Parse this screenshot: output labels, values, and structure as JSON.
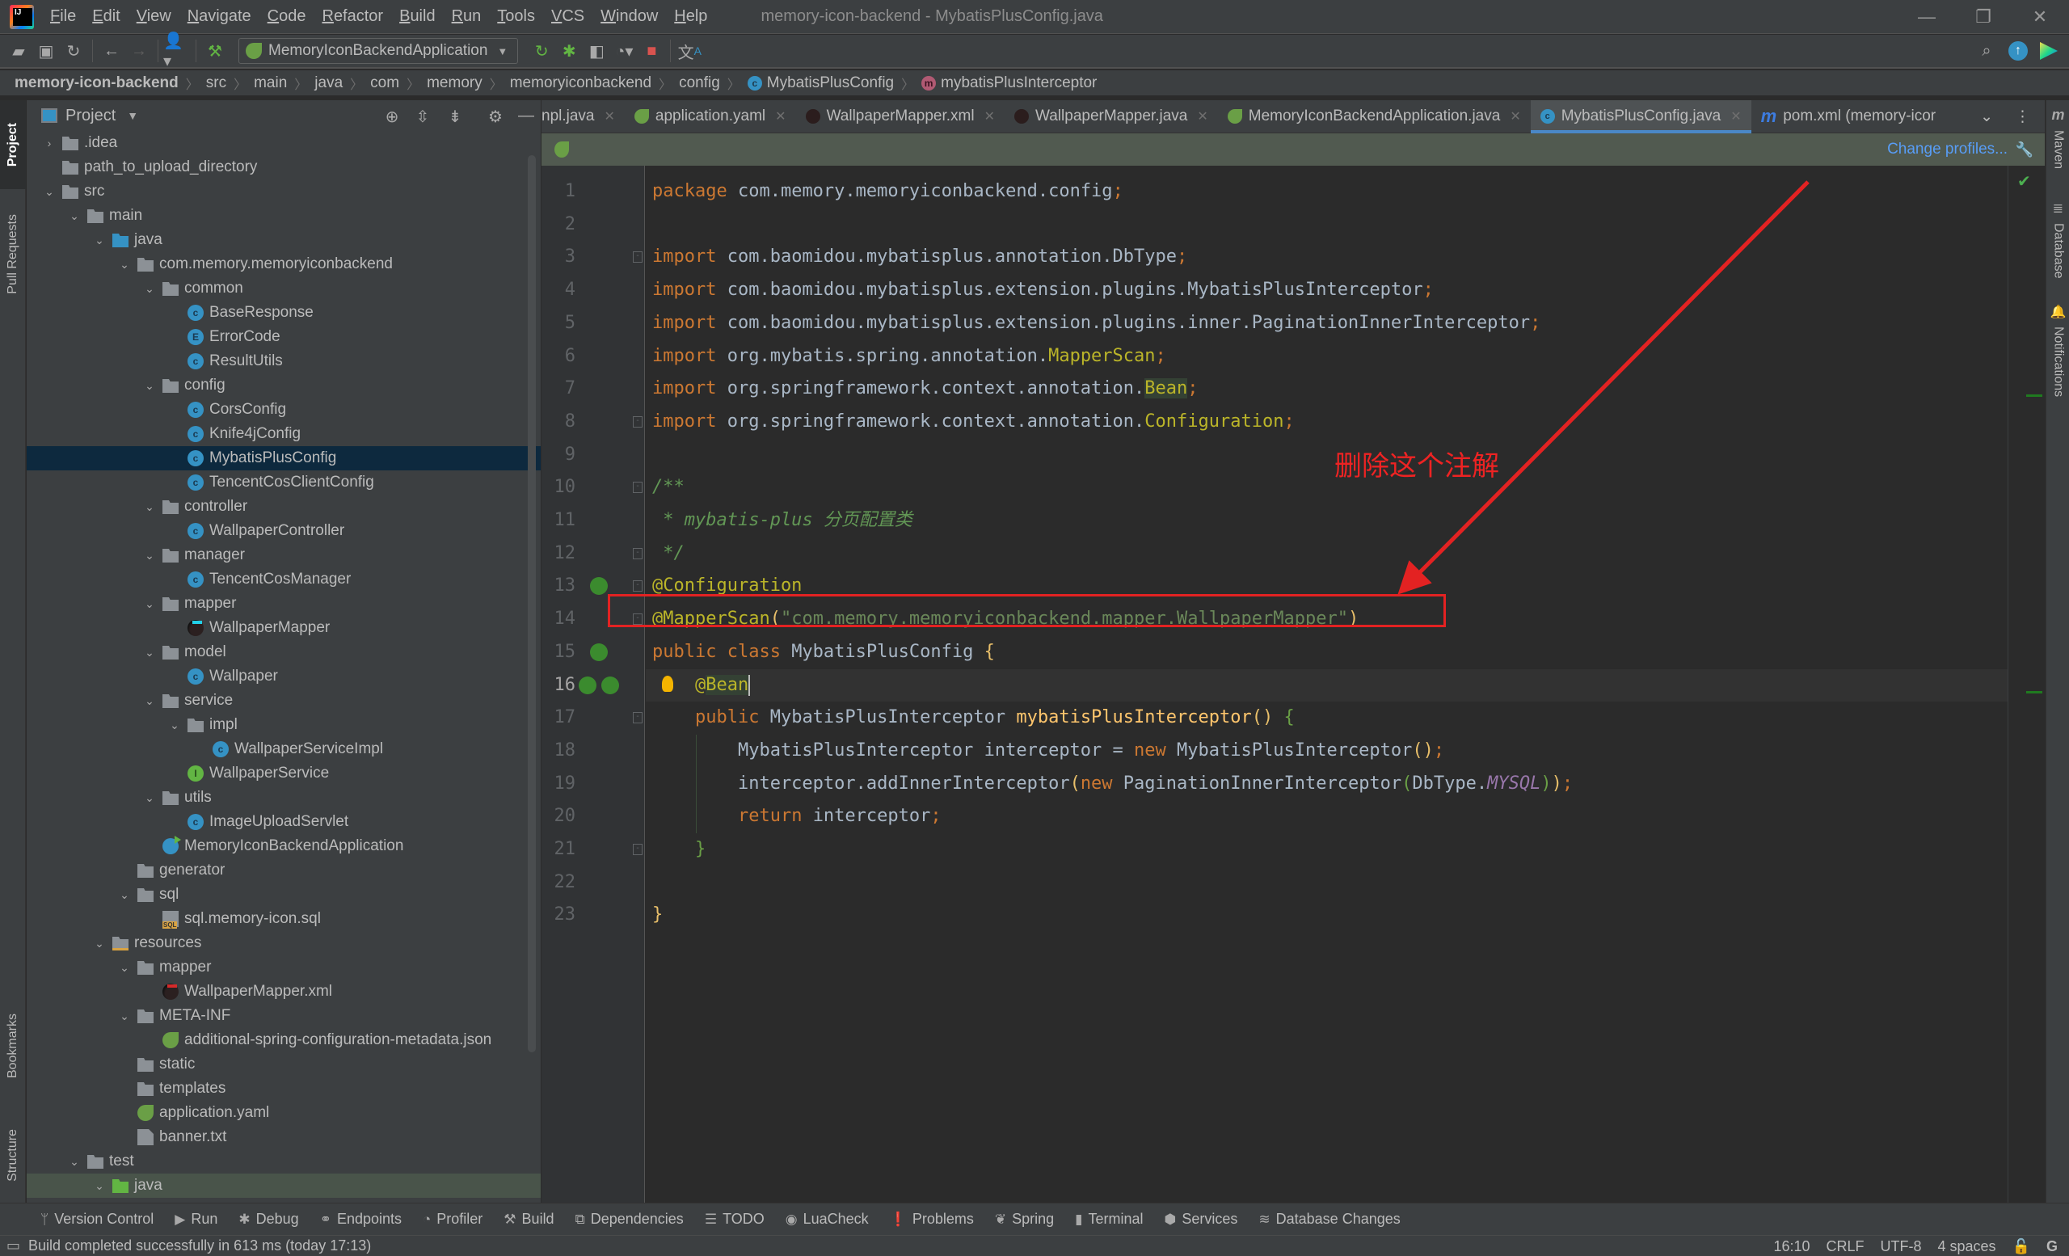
{
  "window": {
    "title": "memory-icon-backend - MybatisPlusConfig.java",
    "menu": [
      "File",
      "Edit",
      "View",
      "Navigate",
      "Code",
      "Refactor",
      "Build",
      "Run",
      "Tools",
      "VCS",
      "Window",
      "Help"
    ],
    "controls": {
      "minimize": "—",
      "restore": "❐",
      "close": "✕"
    }
  },
  "toolbar": {
    "run_config": "MemoryIconBackendApplication",
    "icons": [
      "open-folder-icon",
      "save-icon",
      "sync-icon",
      "back-icon",
      "forward-icon",
      "user-icon",
      "build-hammer-icon",
      "rerun-icon",
      "debug-icon",
      "coverage-icon",
      "profile-icon",
      "stop-icon",
      "translate-icon",
      "search-icon",
      "update-icon",
      "codewithme-icon"
    ]
  },
  "breadcrumb": [
    "memory-icon-backend",
    "src",
    "main",
    "java",
    "com",
    "memory",
    "memoryiconbackend",
    "config",
    "MybatisPlusConfig",
    "mybatisPlusInterceptor"
  ],
  "left_stripe": {
    "project": "Project",
    "pull_requests": "Pull Requests",
    "bookmarks": "Bookmarks",
    "structure": "Structure"
  },
  "right_stripe": {
    "maven": "Maven",
    "database": "Database",
    "notifications": "Notifications"
  },
  "project_panel": {
    "title": "Project",
    "tree": [
      {
        "label": ".idea",
        "depth": 0,
        "type": "folder",
        "arrow": "›"
      },
      {
        "label": "path_to_upload_directory",
        "depth": 0,
        "type": "folder",
        "arrow": ""
      },
      {
        "label": "src",
        "depth": 0,
        "type": "folder",
        "arrow": "⌄"
      },
      {
        "label": "main",
        "depth": 1,
        "type": "folder",
        "arrow": "⌄"
      },
      {
        "label": "java",
        "depth": 2,
        "type": "src-folder",
        "arrow": "⌄"
      },
      {
        "label": "com.memory.memoryiconbackend",
        "depth": 3,
        "type": "pkg",
        "arrow": "⌄"
      },
      {
        "label": "common",
        "depth": 4,
        "type": "pkg",
        "arrow": "⌄"
      },
      {
        "label": "BaseResponse",
        "depth": 5,
        "type": "cls",
        "arrow": ""
      },
      {
        "label": "ErrorCode",
        "depth": 5,
        "type": "enum",
        "arrow": ""
      },
      {
        "label": "ResultUtils",
        "depth": 5,
        "type": "cls",
        "arrow": ""
      },
      {
        "label": "config",
        "depth": 4,
        "type": "pkg",
        "arrow": "⌄"
      },
      {
        "label": "CorsConfig",
        "depth": 5,
        "type": "cls",
        "arrow": ""
      },
      {
        "label": "Knife4jConfig",
        "depth": 5,
        "type": "cls",
        "arrow": ""
      },
      {
        "label": "MybatisPlusConfig",
        "depth": 5,
        "type": "cls",
        "arrow": "",
        "selected": true
      },
      {
        "label": "TencentCosClientConfig",
        "depth": 5,
        "type": "cls",
        "arrow": ""
      },
      {
        "label": "controller",
        "depth": 4,
        "type": "pkg",
        "arrow": "⌄"
      },
      {
        "label": "WallpaperController",
        "depth": 5,
        "type": "cls",
        "arrow": ""
      },
      {
        "label": "manager",
        "depth": 4,
        "type": "pkg",
        "arrow": "⌄"
      },
      {
        "label": "TencentCosManager",
        "depth": 5,
        "type": "cls",
        "arrow": ""
      },
      {
        "label": "mapper",
        "depth": 4,
        "type": "pkg",
        "arrow": "⌄"
      },
      {
        "label": "WallpaperMapper",
        "depth": 5,
        "type": "mybatis-blue",
        "arrow": ""
      },
      {
        "label": "model",
        "depth": 4,
        "type": "pkg",
        "arrow": "⌄"
      },
      {
        "label": "Wallpaper",
        "depth": 5,
        "type": "cls",
        "arrow": ""
      },
      {
        "label": "service",
        "depth": 4,
        "type": "pkg",
        "arrow": "⌄"
      },
      {
        "label": "impl",
        "depth": 5,
        "type": "pkg",
        "arrow": "⌄"
      },
      {
        "label": "WallpaperServiceImpl",
        "depth": 6,
        "type": "cls",
        "arrow": ""
      },
      {
        "label": "WallpaperService",
        "depth": 5,
        "type": "iface",
        "arrow": ""
      },
      {
        "label": "utils",
        "depth": 4,
        "type": "pkg",
        "arrow": "⌄"
      },
      {
        "label": "ImageUploadServlet",
        "depth": 5,
        "type": "cls",
        "arrow": ""
      },
      {
        "label": "MemoryIconBackendApplication",
        "depth": 4,
        "type": "app-class",
        "arrow": ""
      },
      {
        "label": "generator",
        "depth": 3,
        "type": "pkg",
        "arrow": ""
      },
      {
        "label": "sql",
        "depth": 3,
        "type": "pkg",
        "arrow": "⌄"
      },
      {
        "label": "sql.memory-icon.sql",
        "depth": 4,
        "type": "sqlfile",
        "arrow": ""
      },
      {
        "label": "resources",
        "depth": 2,
        "type": "res-folder",
        "arrow": "⌄"
      },
      {
        "label": "mapper",
        "depth": 3,
        "type": "folder",
        "arrow": "⌄"
      },
      {
        "label": "WallpaperMapper.xml",
        "depth": 4,
        "type": "mybatis-red",
        "arrow": ""
      },
      {
        "label": "META-INF",
        "depth": 3,
        "type": "folder",
        "arrow": "⌄"
      },
      {
        "label": "additional-spring-configuration-metadata.json",
        "depth": 4,
        "type": "spring",
        "arrow": ""
      },
      {
        "label": "static",
        "depth": 3,
        "type": "folder",
        "arrow": ""
      },
      {
        "label": "templates",
        "depth": 3,
        "type": "folder",
        "arrow": ""
      },
      {
        "label": "application.yaml",
        "depth": 3,
        "type": "spring",
        "arrow": ""
      },
      {
        "label": "banner.txt",
        "depth": 3,
        "type": "txtfile",
        "arrow": ""
      },
      {
        "label": "test",
        "depth": 1,
        "type": "folder",
        "arrow": "⌄"
      },
      {
        "label": "java",
        "depth": 2,
        "type": "test-folder",
        "arrow": "⌄",
        "test": true
      }
    ]
  },
  "editor": {
    "tabs": [
      {
        "label": "npl.java",
        "icon": "none",
        "closable": true
      },
      {
        "label": "application.yaml",
        "icon": "spring",
        "closable": true
      },
      {
        "label": "WallpaperMapper.xml",
        "icon": "mybatis",
        "closable": true
      },
      {
        "label": "WallpaperMapper.java",
        "icon": "mybatis",
        "closable": true
      },
      {
        "label": "MemoryIconBackendApplication.java",
        "icon": "spring",
        "closable": true
      },
      {
        "label": "MybatisPlusConfig.java",
        "icon": "cls",
        "closable": true,
        "active": true
      },
      {
        "label": "pom.xml (memory-icor",
        "icon": "maven",
        "closable": false
      }
    ],
    "banner_link": "Change profiles...",
    "current_line": 16,
    "lines": [
      {
        "n": 1,
        "tokens": [
          [
            "kw",
            "package "
          ],
          [
            "",
            "com.memory.memoryiconbackend.config"
          ],
          [
            "kw",
            ";"
          ]
        ]
      },
      {
        "n": 2,
        "tokens": []
      },
      {
        "n": 3,
        "tokens": [
          [
            "kw",
            "import "
          ],
          [
            "",
            "com.baomidou.mybatisplus.annotation.DbType"
          ],
          [
            "kw",
            ";"
          ]
        ]
      },
      {
        "n": 4,
        "tokens": [
          [
            "kw",
            "import "
          ],
          [
            "",
            "com.baomidou.mybatisplus.extension.plugins.MybatisPlusInterceptor"
          ],
          [
            "kw",
            ";"
          ]
        ]
      },
      {
        "n": 5,
        "tokens": [
          [
            "kw",
            "import "
          ],
          [
            "",
            "com.baomidou.mybatisplus.extension.plugins.inner.PaginationInnerInterceptor"
          ],
          [
            "kw",
            ";"
          ]
        ]
      },
      {
        "n": 6,
        "tokens": [
          [
            "kw",
            "import "
          ],
          [
            "",
            "org.mybatis.spring.annotation."
          ],
          [
            "ann",
            "MapperScan"
          ],
          [
            "kw",
            ";"
          ]
        ]
      },
      {
        "n": 7,
        "tokens": [
          [
            "kw",
            "import "
          ],
          [
            "",
            "org.springframework.context.annotation."
          ],
          [
            "ann hl-bean",
            "Bean"
          ],
          [
            "kw",
            ";"
          ]
        ]
      },
      {
        "n": 8,
        "tokens": [
          [
            "kw",
            "import "
          ],
          [
            "",
            "org.springframework.context.annotation."
          ],
          [
            "ann",
            "Configuration"
          ],
          [
            "kw",
            ";"
          ]
        ]
      },
      {
        "n": 9,
        "tokens": []
      },
      {
        "n": 10,
        "tokens": [
          [
            "cmt",
            "/**"
          ]
        ]
      },
      {
        "n": 11,
        "tokens": [
          [
            "cmt",
            " * mybatis-plus 分页配置类"
          ]
        ]
      },
      {
        "n": 12,
        "tokens": [
          [
            "cmt",
            " */"
          ]
        ]
      },
      {
        "n": 13,
        "tokens": [
          [
            "ann",
            "@Configuration"
          ]
        ]
      },
      {
        "n": 14,
        "tokens": [
          [
            "ann",
            "@MapperScan"
          ],
          [
            "br-y",
            "("
          ],
          [
            "str",
            "\"com.memory.memoryiconbackend.mapper.WallpaperMapper\""
          ],
          [
            "br-y",
            ")"
          ]
        ]
      },
      {
        "n": 15,
        "tokens": [
          [
            "kw",
            "public class "
          ],
          [
            "",
            "MybatisPlusConfig "
          ],
          [
            "br-y",
            "{"
          ]
        ]
      },
      {
        "n": 16,
        "tokens": [
          [
            "",
            "    "
          ],
          [
            "ann",
            "@"
          ],
          [
            "ann hl-bean",
            "Bean"
          ]
        ]
      },
      {
        "n": 17,
        "tokens": [
          [
            "",
            "    "
          ],
          [
            "kw",
            "public "
          ],
          [
            "",
            "MybatisPlusInterceptor "
          ],
          [
            "fn",
            "mybatisPlusInterceptor"
          ],
          [
            "br-y",
            "() "
          ],
          [
            "br-g",
            "{"
          ]
        ]
      },
      {
        "n": 18,
        "tokens": [
          [
            "",
            "        MybatisPlusInterceptor interceptor = "
          ],
          [
            "kw",
            "new "
          ],
          [
            "",
            "MybatisPlusInterceptor"
          ],
          [
            "br-y",
            "()"
          ],
          [
            "kw",
            ";"
          ]
        ]
      },
      {
        "n": 19,
        "tokens": [
          [
            "",
            "        interceptor.addInnerInterceptor"
          ],
          [
            "br-y",
            "("
          ],
          [
            "kw",
            "new "
          ],
          [
            "",
            "PaginationInnerInterceptor"
          ],
          [
            "br-g",
            "("
          ],
          [
            "",
            "DbType."
          ],
          [
            "enum-const",
            "MYSQL"
          ],
          [
            "br-g",
            ")"
          ],
          [
            "br-y",
            ")"
          ],
          [
            "kw",
            ";"
          ]
        ]
      },
      {
        "n": 20,
        "tokens": [
          [
            "",
            "        "
          ],
          [
            "kw",
            "return "
          ],
          [
            "",
            "interceptor"
          ],
          [
            "kw",
            ";"
          ]
        ]
      },
      {
        "n": 21,
        "tokens": [
          [
            "",
            "    "
          ],
          [
            "br-g",
            "}"
          ]
        ]
      },
      {
        "n": 22,
        "tokens": []
      },
      {
        "n": 23,
        "tokens": [
          [
            "br-y",
            "}"
          ]
        ]
      }
    ]
  },
  "annotation": {
    "text": "删除这个注解",
    "color": "#e32222"
  },
  "bottom_tools": [
    "Version Control",
    "Run",
    "Debug",
    "Endpoints",
    "Profiler",
    "Build",
    "Dependencies",
    "TODO",
    "LuaCheck",
    "Problems",
    "Spring",
    "Terminal",
    "Services",
    "Database Changes"
  ],
  "status": {
    "message": "Build completed successfully in 613 ms (today 17:13)",
    "position": "16:10",
    "line_sep": "CRLF",
    "encoding": "UTF-8",
    "indent": "4 spaces"
  },
  "colors": {
    "accent": "#4a88c7",
    "link": "#589df6",
    "annotation_red": "#e32222",
    "selection": "#0d293e"
  }
}
